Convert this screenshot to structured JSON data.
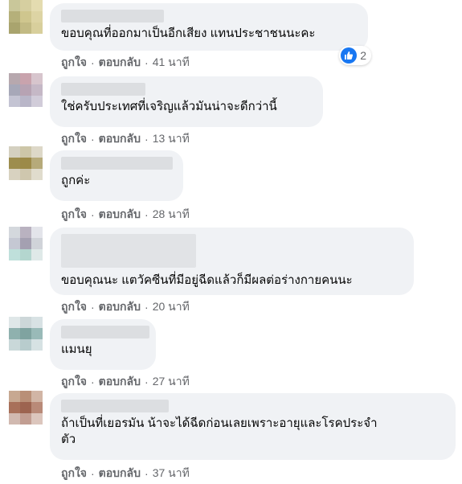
{
  "comments": [
    {
      "text": "ขอบคุณที่ออกมาเป็นอีกเสียง แทนประชาชนนะคะ",
      "like_label": "ถูกใจ",
      "reply_label": "ตอบกลับ",
      "time": "41 นาที",
      "reaction": {
        "icon": "like-icon",
        "count": "2"
      }
    },
    {
      "text": "ใช่ครับประเทศที่เจริญแล้วมันน่าจะดีกว่านี้",
      "like_label": "ถูกใจ",
      "reply_label": "ตอบกลับ",
      "time": "13 นาที"
    },
    {
      "text": "ถูกค่ะ",
      "like_label": "ถูกใจ",
      "reply_label": "ตอบกลับ",
      "time": "28 นาที"
    },
    {
      "text": "ขอบคุณนะ แตวัคซีนที่มีอยู่ฉีดแล้วก็มีผลต่อร่างกายคนนะ",
      "like_label": "ถูกใจ",
      "reply_label": "ตอบกลับ",
      "time": "20 นาที"
    },
    {
      "text": "แมนยุ",
      "like_label": "ถูกใจ",
      "reply_label": "ตอบกลับ",
      "time": "27 นาที"
    },
    {
      "text": "ถ้าเป็นที่เยอรมัน น้าจะได้ฉีดก่อนเลยเพราะอายุและโรคประจำ\nตัว",
      "like_label": "ถูกใจ",
      "reply_label": "ตอบกลับ",
      "time": "37 นาที"
    }
  ],
  "separator": "·",
  "colors": {
    "bubble": "#f0f2f5",
    "meta_text": "#65676b",
    "like_blue": "#1877f2"
  }
}
